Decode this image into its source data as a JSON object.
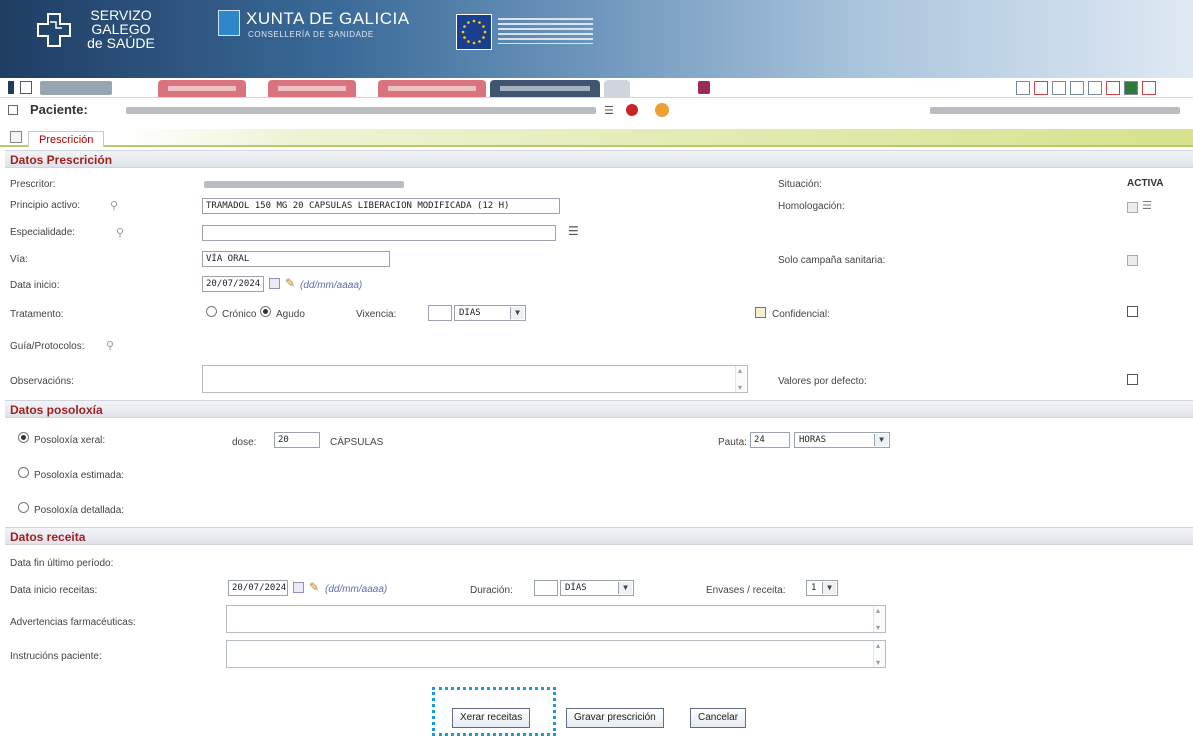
{
  "header": {
    "sergas_text": [
      "SERVIZO",
      "GALEGO",
      "de SAÚDE"
    ],
    "xunta_title": "XUNTA DE GALICIA",
    "xunta_subtitle": "CONSELLERÍA DE SANIDADE"
  },
  "patient": {
    "label": "Paciente:"
  },
  "tab": {
    "label": "Prescrición"
  },
  "sections": {
    "prescripcion": "Datos Prescrición",
    "posoloxia": "Datos posoloxía",
    "receita": "Datos receita"
  },
  "prescripcion": {
    "prescritor_label": "Prescritor:",
    "situacion_label": "Situación:",
    "situacion_value": "ACTIVA",
    "principio_label": "Principio activo:",
    "principio_value": "TRAMADOL 150 MG 20 CAPSULAS LIBERACION MODIFICADA (12 H)",
    "homologacion_label": "Homologación:",
    "especialidade_label": "Especialidade:",
    "especialidade_value": "",
    "via_label": "Vía:",
    "via_value": "VÍA ORAL",
    "solo_label": "Solo campaña sanitaria:",
    "data_inicio_label": "Data inicio:",
    "data_inicio_value": "20/07/2024",
    "date_hint": "(dd/mm/aaaa)",
    "tratamento_label": "Tratamento:",
    "cronico_label": "Crónico",
    "agudo_label": "Agudo",
    "vixencia_label": "Vixencia:",
    "vixencia_value": "",
    "vixencia_unit": "DIAS",
    "confidencial_label": "Confidencial:",
    "guia_label": "Guía/Protocolos:",
    "observacions_label": "Observacións:",
    "valores_label": "Valores por defecto:"
  },
  "posoloxia": {
    "xeral_label": "Posoloxía xeral:",
    "dose_label": "dose:",
    "dose_value": "20",
    "dose_unit": "CÁPSULAS",
    "pauta_label": "Pauta:",
    "pauta_value": "24",
    "pauta_unit": "HORAS",
    "estimada_label": "Posoloxía estimada:",
    "detallada_label": "Posoloxía detallada:"
  },
  "receita": {
    "data_fin_label": "Data fin último período:",
    "data_inicio_label": "Data inicio receitas:",
    "data_inicio_value": "20/07/2024",
    "date_hint": "(dd/mm/aaaa)",
    "duracion_label": "Duración:",
    "duracion_value": "",
    "duracion_unit": "DÍAS",
    "envases_label": "Envases / receita:",
    "envases_value": "1",
    "advertencias_label": "Advertencias farmacéuticas:",
    "instrucions_label": "Instrucións paciente:"
  },
  "buttons": {
    "xerar": "Xerar receitas",
    "gardar": "Gravar prescrición",
    "cancelar": "Cancelar"
  },
  "colors": {
    "section_title": "#9f1f1f",
    "focus_ring": "#1a9ad6"
  }
}
